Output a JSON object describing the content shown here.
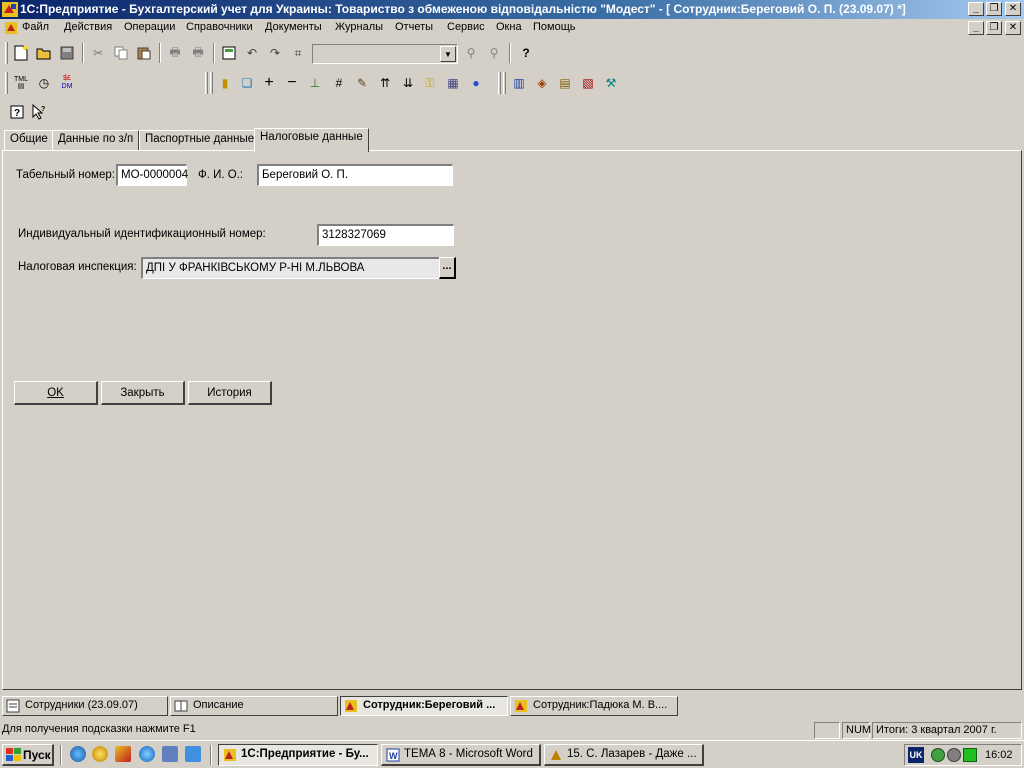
{
  "window": {
    "title": "1С:Предприятие - Бухгалтерский учет для Украины: Товариство з обмеженою відповідальністю \"Модест\" - [ Сотрудник:Береговий О. П. (23.09.07) *]",
    "minimize": "_",
    "restore": "❐",
    "close": "✕"
  },
  "menu": [
    "Файл",
    "Действия",
    "Операции",
    "Справочники",
    "Документы",
    "Журналы",
    "Отчеты",
    "Сервис",
    "Окна",
    "Помощь"
  ],
  "toolbar": {
    "tml_label": "TML",
    "dm_label": "DM"
  },
  "tabs": [
    "Общие",
    "Данные по з/п",
    "Паспортные данные",
    "Налоговые данные"
  ],
  "active_tab": "Налоговые данные",
  "form": {
    "tab_number_label": "Табельный номер:",
    "tab_number_value": "МО-0000004",
    "fio_label": "Ф. И. О.:",
    "fio_value": "Береговий О. П.",
    "inn_label": "Индивидуальный идентификационный номер:",
    "inn_value": "3128327069",
    "tax_label": "Налоговая инспекция:",
    "tax_value": "ДПІ У ФРАНКІВСЬКОМУ Р-НІ М.ЛЬВОВА",
    "tax_select": "...",
    "ok": "OK",
    "close": "Закрыть",
    "history": "История"
  },
  "window_tabs": [
    "Сотрудники (23.09.07)",
    "Описание",
    "Сотрудник:Береговий ...",
    "Сотрудник:Падюка М. В...."
  ],
  "status": {
    "hint": "Для получения подсказки нажмите F1",
    "num": "NUM",
    "totals": "Итоги: 3 квартал 2007 г."
  },
  "taskbar": {
    "start": "Пуск",
    "items": [
      "1С:Предприятие - Бу...",
      "ТЕМА 8 - Microsoft Word",
      "15. С. Лазарев - Даже ..."
    ],
    "lang": "UK",
    "time": "16:02"
  }
}
